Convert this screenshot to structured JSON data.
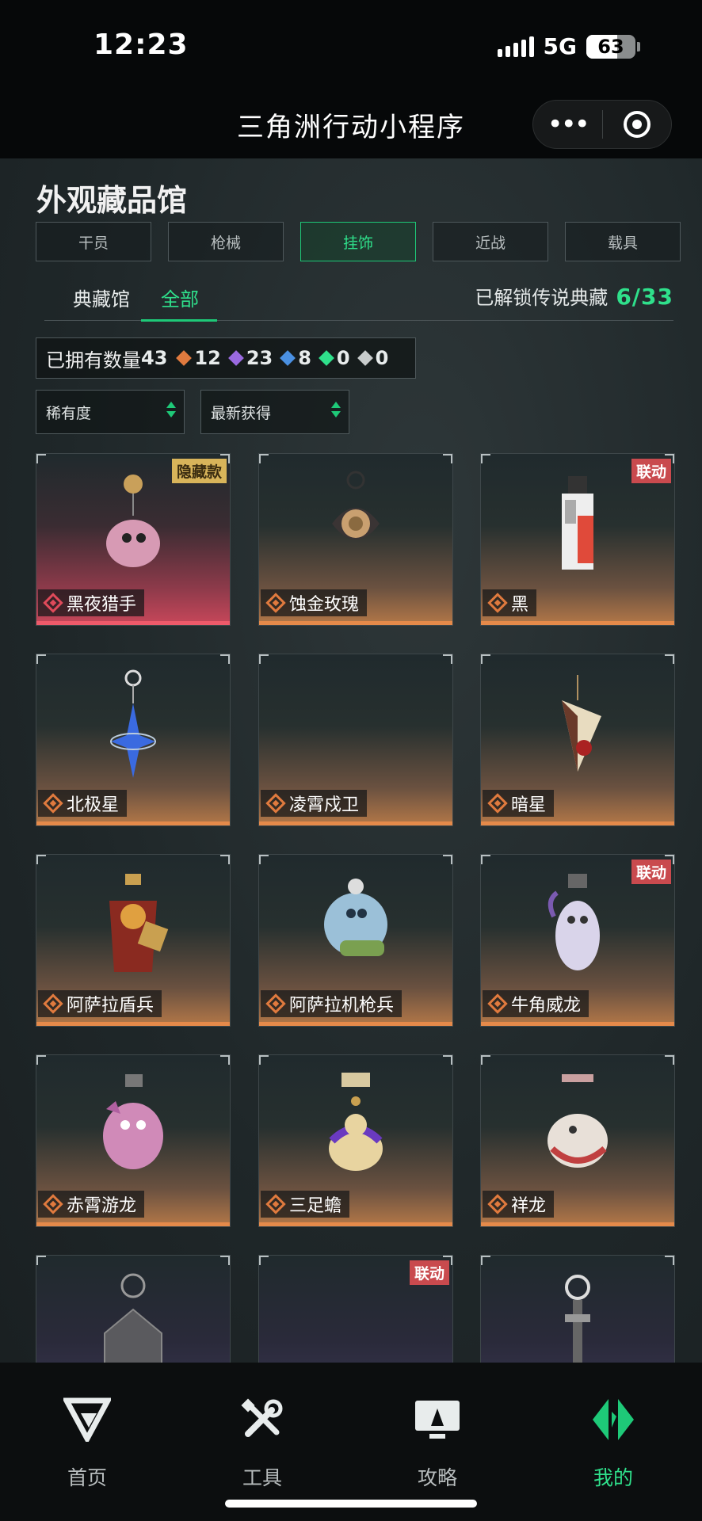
{
  "status_bar": {
    "time": "12:23",
    "network": "5G",
    "battery": "63",
    "battery_level": 0.63
  },
  "title_bar": {
    "title": "三角洲行动小程序",
    "more_icon": "more-dots-icon",
    "close_icon": "target-circle-icon"
  },
  "page": {
    "title": "外观藏品馆",
    "category_tabs": [
      {
        "label": "干员",
        "active": false
      },
      {
        "label": "枪械",
        "active": false
      },
      {
        "label": "挂饰",
        "active": true
      },
      {
        "label": "近战",
        "active": false
      },
      {
        "label": "载具",
        "active": false
      }
    ],
    "sub_tabs": [
      {
        "label": "典藏馆",
        "active": false
      },
      {
        "label": "全部",
        "active": true
      }
    ],
    "unlock": {
      "label": "已解锁传说典藏",
      "value": "6/33"
    },
    "owned": {
      "label": "已拥有数量",
      "total": "43",
      "gems": [
        {
          "count": "12",
          "color": "#e07a3e",
          "icon": "orange-rarity-icon"
        },
        {
          "count": "23",
          "color": "#9a6ae0",
          "icon": "purple-rarity-icon"
        },
        {
          "count": "8",
          "color": "#4a90e2",
          "icon": "blue-rarity-icon"
        },
        {
          "count": "0",
          "color": "#2fe08b",
          "icon": "green-rarity-icon"
        },
        {
          "count": "0",
          "color": "#c8cccc",
          "icon": "white-rarity-icon"
        }
      ]
    },
    "filters": [
      {
        "label": "稀有度"
      },
      {
        "label": "最新获得"
      }
    ]
  },
  "items": [
    {
      "name": "黑夜猎手",
      "badge": "隐藏款",
      "rarity": "red"
    },
    {
      "name": "蚀金玫瑰",
      "badge": "",
      "rarity": "orange"
    },
    {
      "name": "黑",
      "badge": "联动",
      "rarity": "orange"
    },
    {
      "name": "北极星",
      "badge": "",
      "rarity": "orange"
    },
    {
      "name": "凌霄戍卫",
      "badge": "",
      "rarity": "orange"
    },
    {
      "name": "暗星",
      "badge": "",
      "rarity": "orange"
    },
    {
      "name": "阿萨拉盾兵",
      "badge": "",
      "rarity": "orange"
    },
    {
      "name": "阿萨拉机枪兵",
      "badge": "",
      "rarity": "orange"
    },
    {
      "name": "牛角威龙",
      "badge": "联动",
      "rarity": "orange"
    },
    {
      "name": "赤霄游龙",
      "badge": "",
      "rarity": "orange"
    },
    {
      "name": "三足蟾",
      "badge": "",
      "rarity": "orange"
    },
    {
      "name": "祥龙",
      "badge": "",
      "rarity": "orange"
    },
    {
      "name": "",
      "badge": "",
      "rarity": "purple"
    },
    {
      "name": "",
      "badge": "联动",
      "rarity": "purple"
    },
    {
      "name": "",
      "badge": "",
      "rarity": "purple"
    }
  ],
  "bottom_nav": [
    {
      "label": "首页",
      "icon": "home-v-logo-icon",
      "active": false
    },
    {
      "label": "工具",
      "icon": "tools-wrench-icon",
      "active": false
    },
    {
      "label": "攻略",
      "icon": "guide-monitor-icon",
      "active": false
    },
    {
      "label": "我的",
      "icon": "profile-logo-icon",
      "active": true
    }
  ],
  "colors": {
    "accent": "#1ec978",
    "accent_text": "#2fe08b",
    "orange": "#e58a4a",
    "red": "#c94a4e",
    "gold": "#d8b45a"
  }
}
